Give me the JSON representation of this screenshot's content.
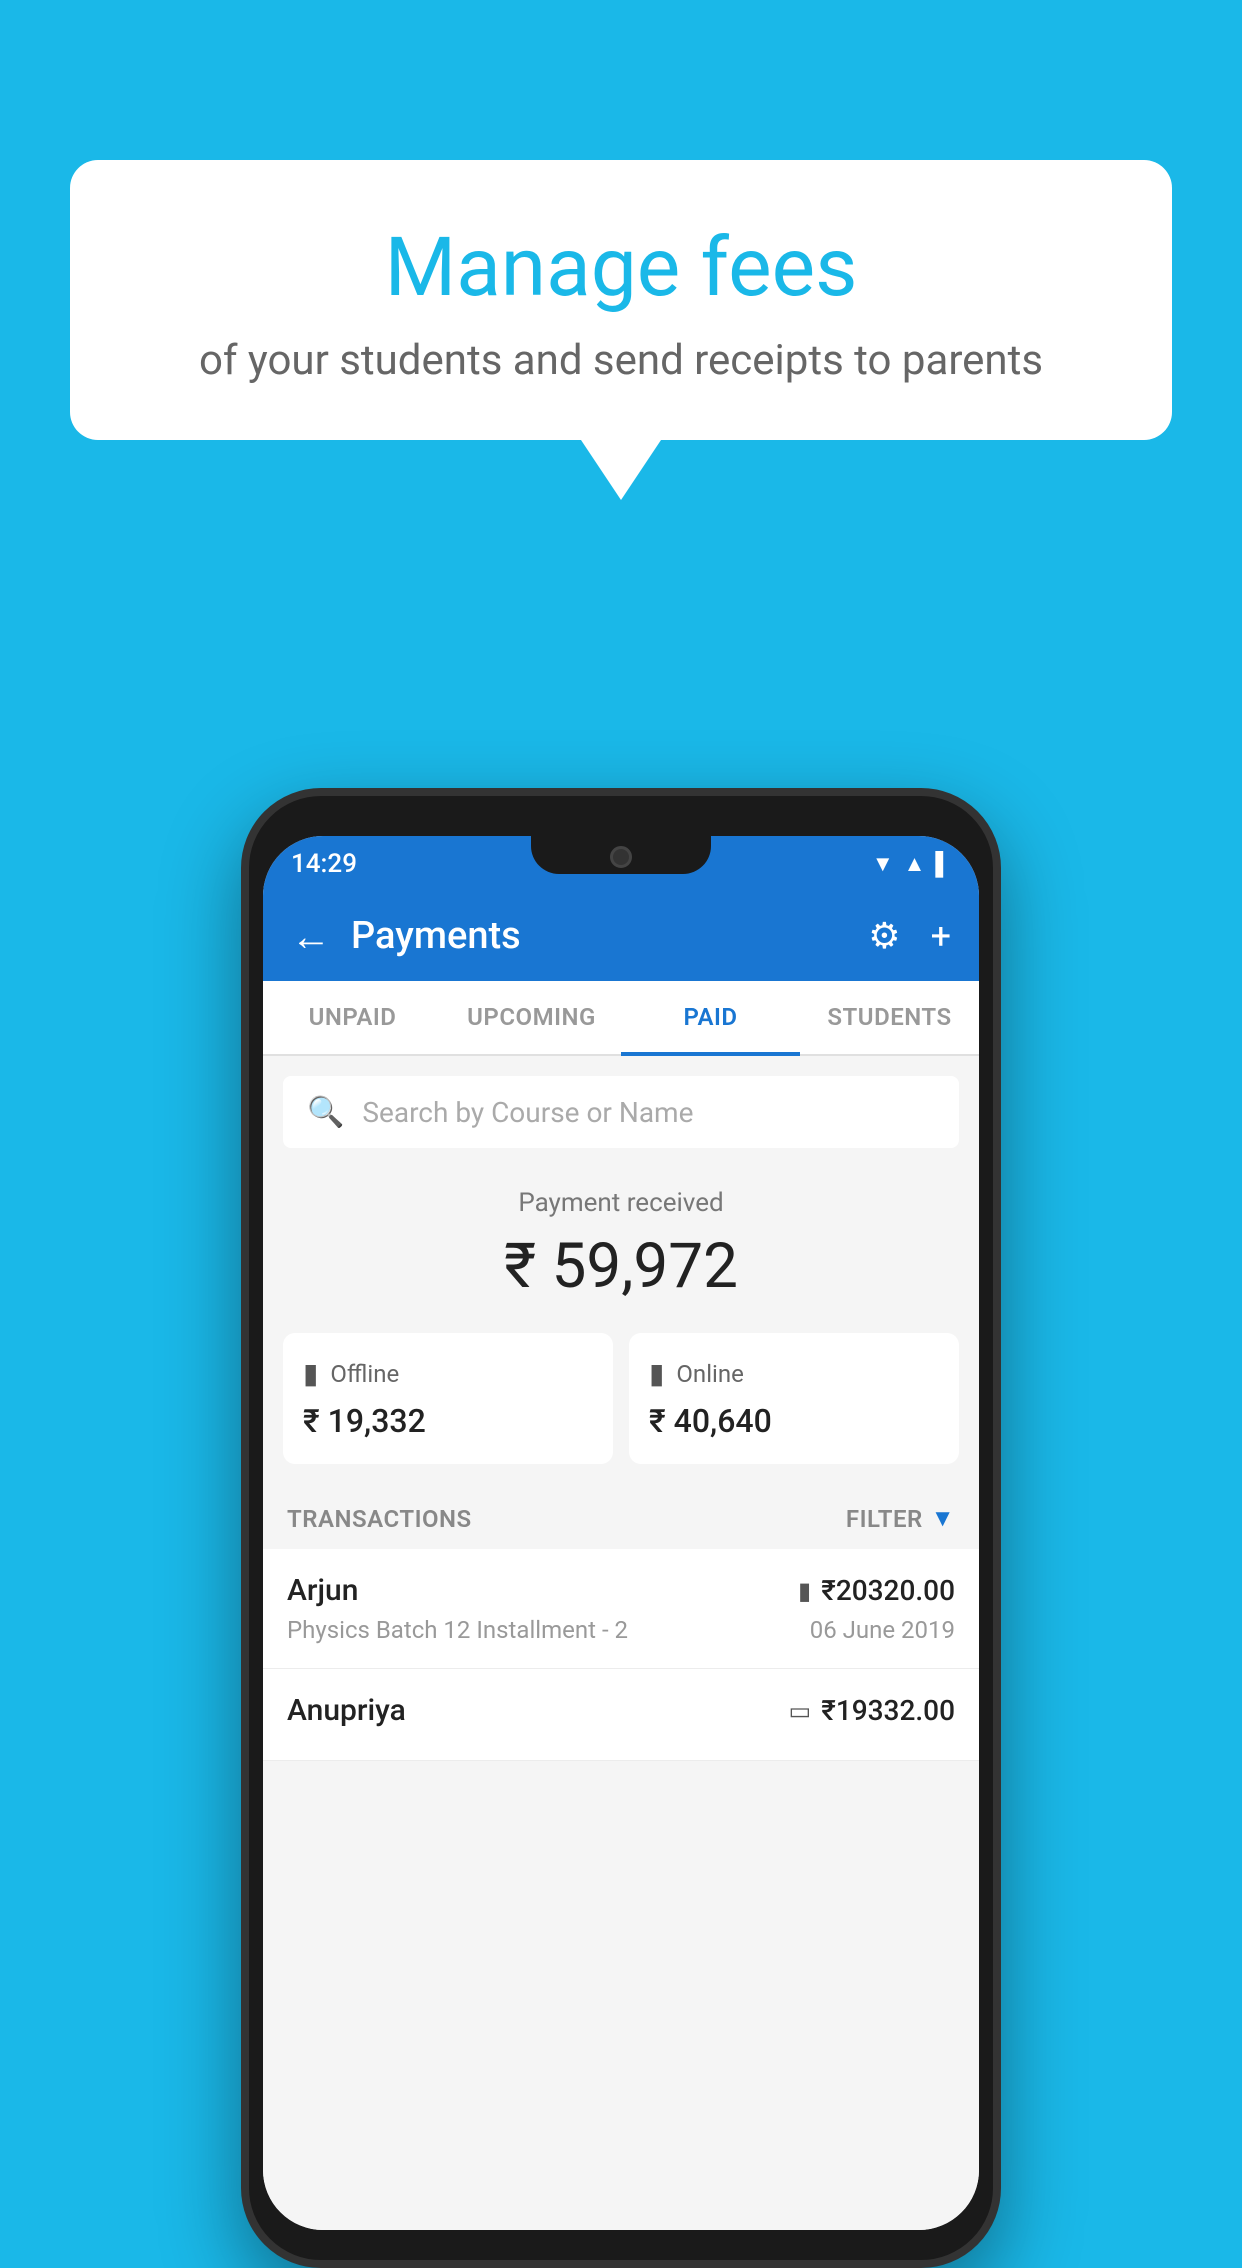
{
  "background_color": "#1ab8e8",
  "speech_bubble": {
    "title": "Manage fees",
    "subtitle": "of your students and send receipts to parents"
  },
  "status_bar": {
    "time": "14:29",
    "wifi_icon": "▲",
    "signal_icon": "▲",
    "battery_icon": "▌"
  },
  "top_bar": {
    "title": "Payments",
    "back_label": "←",
    "settings_label": "⚙",
    "add_label": "+"
  },
  "tabs": [
    {
      "label": "UNPAID",
      "active": false
    },
    {
      "label": "UPCOMING",
      "active": false
    },
    {
      "label": "PAID",
      "active": true
    },
    {
      "label": "STUDENTS",
      "active": false
    }
  ],
  "search": {
    "placeholder": "Search by Course or Name"
  },
  "payment_summary": {
    "label": "Payment received",
    "amount": "₹ 59,972",
    "offline": {
      "label": "Offline",
      "amount": "₹ 19,332"
    },
    "online": {
      "label": "Online",
      "amount": "₹ 40,640"
    }
  },
  "transactions": {
    "header": "TRANSACTIONS",
    "filter_label": "FILTER",
    "items": [
      {
        "name": "Arjun",
        "course": "Physics Batch 12 Installment - 2",
        "amount": "₹20320.00",
        "date": "06 June 2019",
        "mode": "online"
      },
      {
        "name": "Anupriya",
        "course": "",
        "amount": "₹19332.00",
        "date": "",
        "mode": "offline"
      }
    ]
  }
}
